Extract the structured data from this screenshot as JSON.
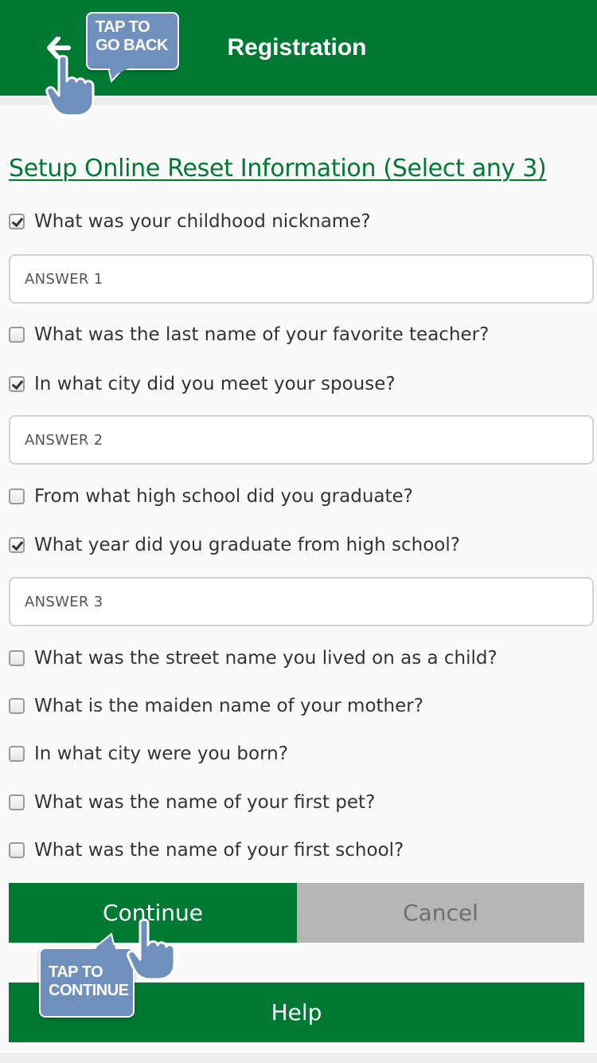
{
  "header": {
    "title": "Registration",
    "back_icon": "arrow-left-icon",
    "color": "#007a33"
  },
  "tips": {
    "go_back": "TAP TO GO BACK",
    "continue": "TAP TO CONTINUE"
  },
  "section": {
    "title": "Setup Online Reset Information (Select any 3)"
  },
  "questions": [
    {
      "label": "What was your childhood nickname?",
      "checked": true
    },
    {
      "label": "What was the last name of your favorite teacher?",
      "checked": false
    },
    {
      "label": "In what city did you meet your spouse?",
      "checked": true
    },
    {
      "label": "From what high school did you graduate?",
      "checked": false
    },
    {
      "label": "What year did you graduate from high school?",
      "checked": true
    },
    {
      "label": "What was the street name you lived on as a child?",
      "checked": false
    },
    {
      "label": "What is the maiden name of your mother?",
      "checked": false
    },
    {
      "label": "In what city were you born?",
      "checked": false
    },
    {
      "label": "What was the name of your first pet?",
      "checked": false
    },
    {
      "label": "What was the name of your first school?",
      "checked": false
    }
  ],
  "answers": [
    {
      "placeholder": "ANSWER 1",
      "value": ""
    },
    {
      "placeholder": "ANSWER 2",
      "value": ""
    },
    {
      "placeholder": "ANSWER 3",
      "value": ""
    }
  ],
  "buttons": {
    "continue": "Continue",
    "cancel": "Cancel",
    "help": "Help"
  },
  "colors": {
    "primary": "#007a33",
    "cancel": "#b6b6b6",
    "tip": "#6f8fbd"
  }
}
